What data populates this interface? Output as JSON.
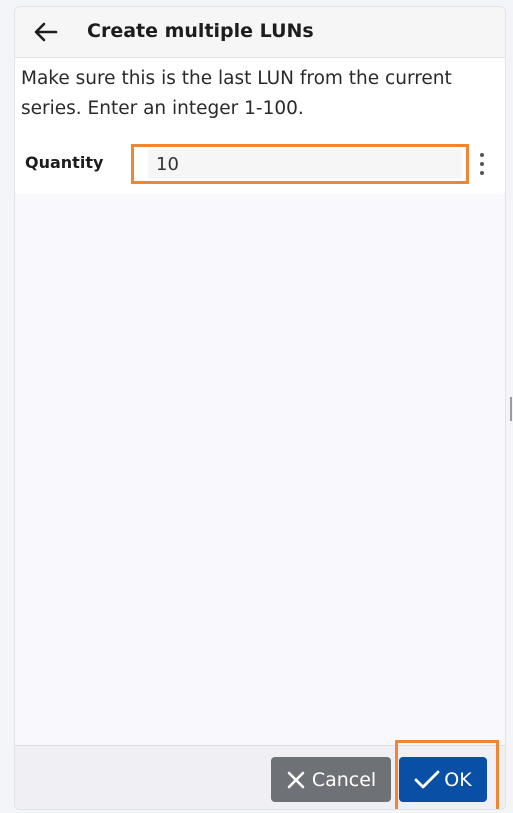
{
  "dialog": {
    "title": "Create multiple LUNs",
    "instructions": "Make sure this is the last LUN from the current series. Enter an integer 1-100.",
    "back_icon": "arrow-left-icon"
  },
  "form": {
    "quantity_label": "Quantity",
    "quantity_value": "10",
    "more_icon": "vertical-ellipsis-icon"
  },
  "footer": {
    "cancel_label": "Cancel",
    "cancel_icon": "close-icon",
    "ok_label": "OK",
    "ok_icon": "checkmark-icon"
  },
  "colors": {
    "primary": "#0a4fa6",
    "secondary": "#6e7176",
    "highlight": "#ef8633"
  }
}
